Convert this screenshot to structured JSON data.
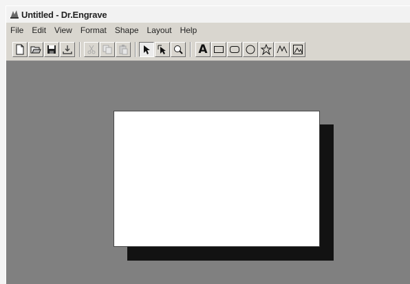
{
  "window": {
    "title": "Untitled - Dr.Engrave"
  },
  "menu": [
    "File",
    "Edit",
    "View",
    "Format",
    "Shape",
    "Layout",
    "Help"
  ],
  "toolbar": {
    "text_tool_glyph": "A",
    "buttons": [
      {
        "name": "new-doc-icon",
        "enabled": true
      },
      {
        "name": "open-folder-icon",
        "enabled": true
      },
      {
        "name": "save-icon",
        "enabled": true
      },
      {
        "name": "download-icon",
        "enabled": true
      },
      {
        "name": "cut-icon",
        "enabled": false
      },
      {
        "name": "copy-icon",
        "enabled": false
      },
      {
        "name": "paste-icon",
        "enabled": false
      },
      {
        "name": "select-arrow-icon",
        "enabled": true,
        "active": true
      },
      {
        "name": "node-edit-icon",
        "enabled": true
      },
      {
        "name": "zoom-icon",
        "enabled": true
      },
      {
        "name": "text-tool-icon",
        "enabled": true
      },
      {
        "name": "rectangle-tool-icon",
        "enabled": true
      },
      {
        "name": "rounded-rectangle-tool-icon",
        "enabled": true
      },
      {
        "name": "ellipse-tool-icon",
        "enabled": true
      },
      {
        "name": "star-tool-icon",
        "enabled": true
      },
      {
        "name": "freehand-line-icon",
        "enabled": true
      },
      {
        "name": "image-tool-icon",
        "enabled": true
      }
    ]
  },
  "colors": {
    "canvas_bg": "#808080",
    "page_bg": "#ffffff",
    "page_shadow": "#121212",
    "disabled_icon": "#a8a8a8"
  }
}
